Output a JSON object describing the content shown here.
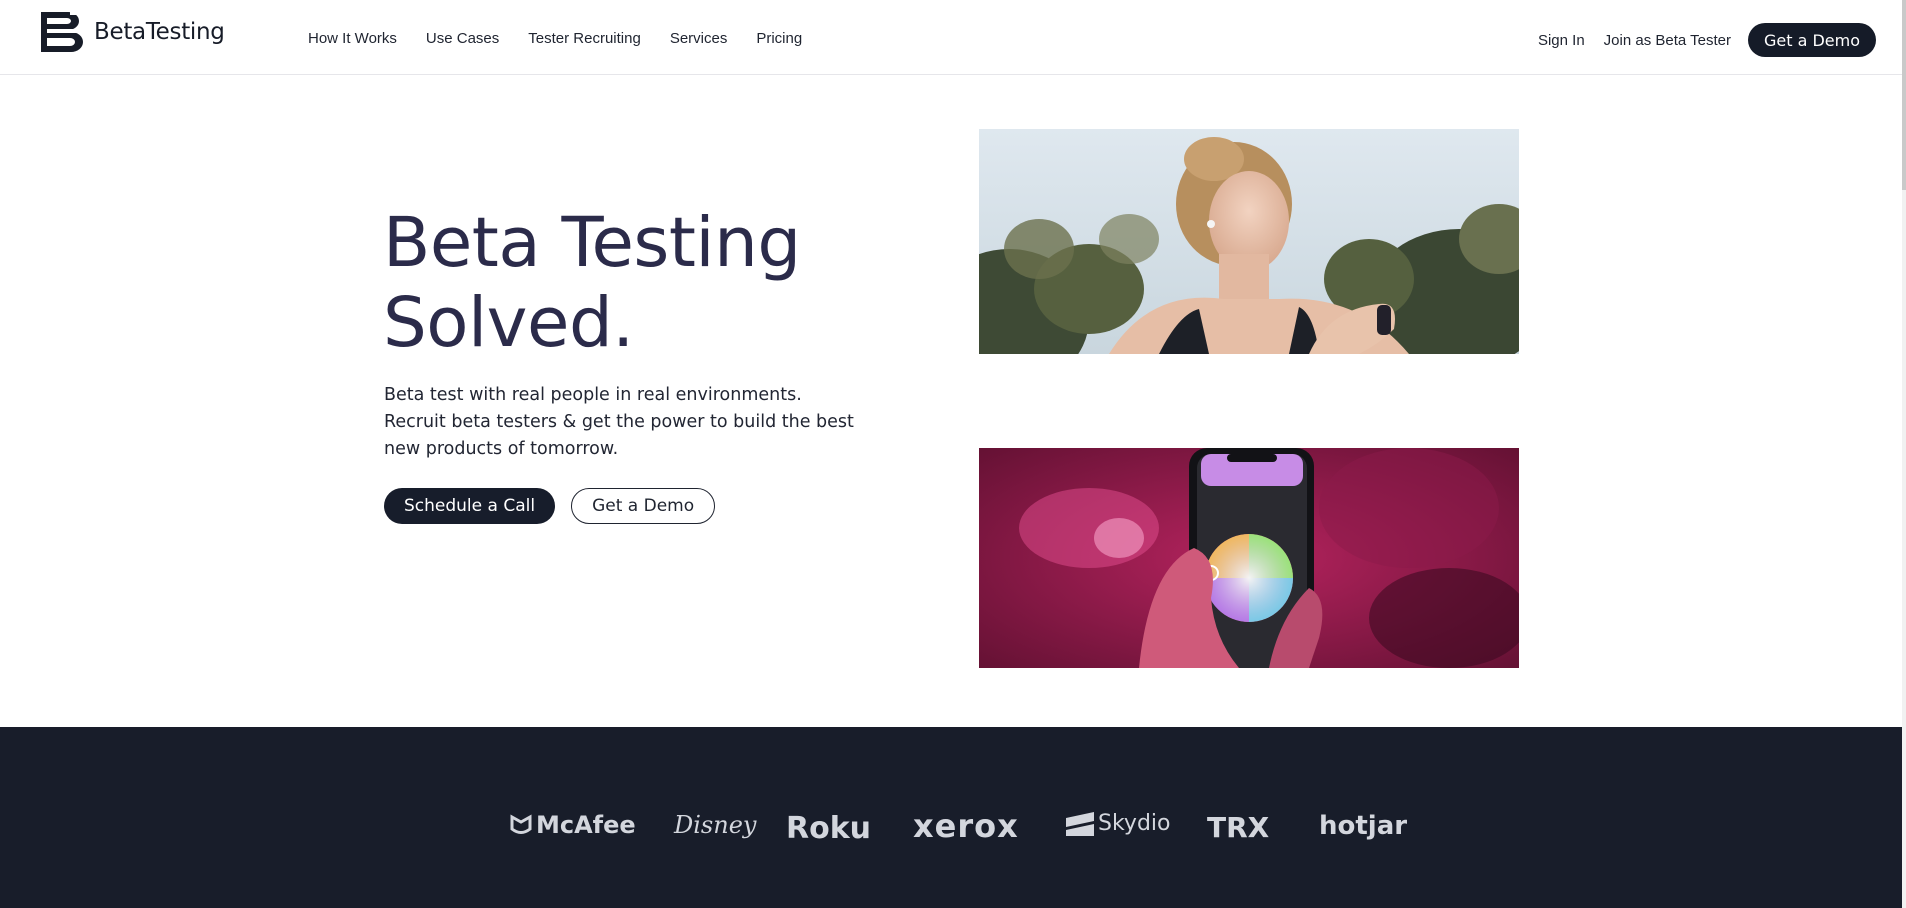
{
  "brand": {
    "name": "BetaTesting"
  },
  "nav": {
    "items": [
      "How It Works",
      "Use Cases",
      "Tester Recruiting",
      "Services",
      "Pricing"
    ]
  },
  "header_right": {
    "sign_in": "Sign In",
    "join": "Join as Beta Tester",
    "demo": "Get a Demo"
  },
  "hero": {
    "title_line1": "Beta Testing",
    "title_line2": "Solved.",
    "subtitle_lines": [
      "Beta test with real people in real environments.",
      "Recruit beta testers & get the power to build the best",
      "new products of tomorrow."
    ],
    "primary_button": "Schedule a Call",
    "secondary_button": "Get a Demo"
  },
  "client_logos": [
    "McAfee",
    "Disney",
    "Roku",
    "xerox",
    "Skydio",
    "TRX",
    "hotjar"
  ],
  "colors": {
    "dark_navy": "#181d2a",
    "title": "#2b2b4a",
    "pink": "#c0236b"
  }
}
